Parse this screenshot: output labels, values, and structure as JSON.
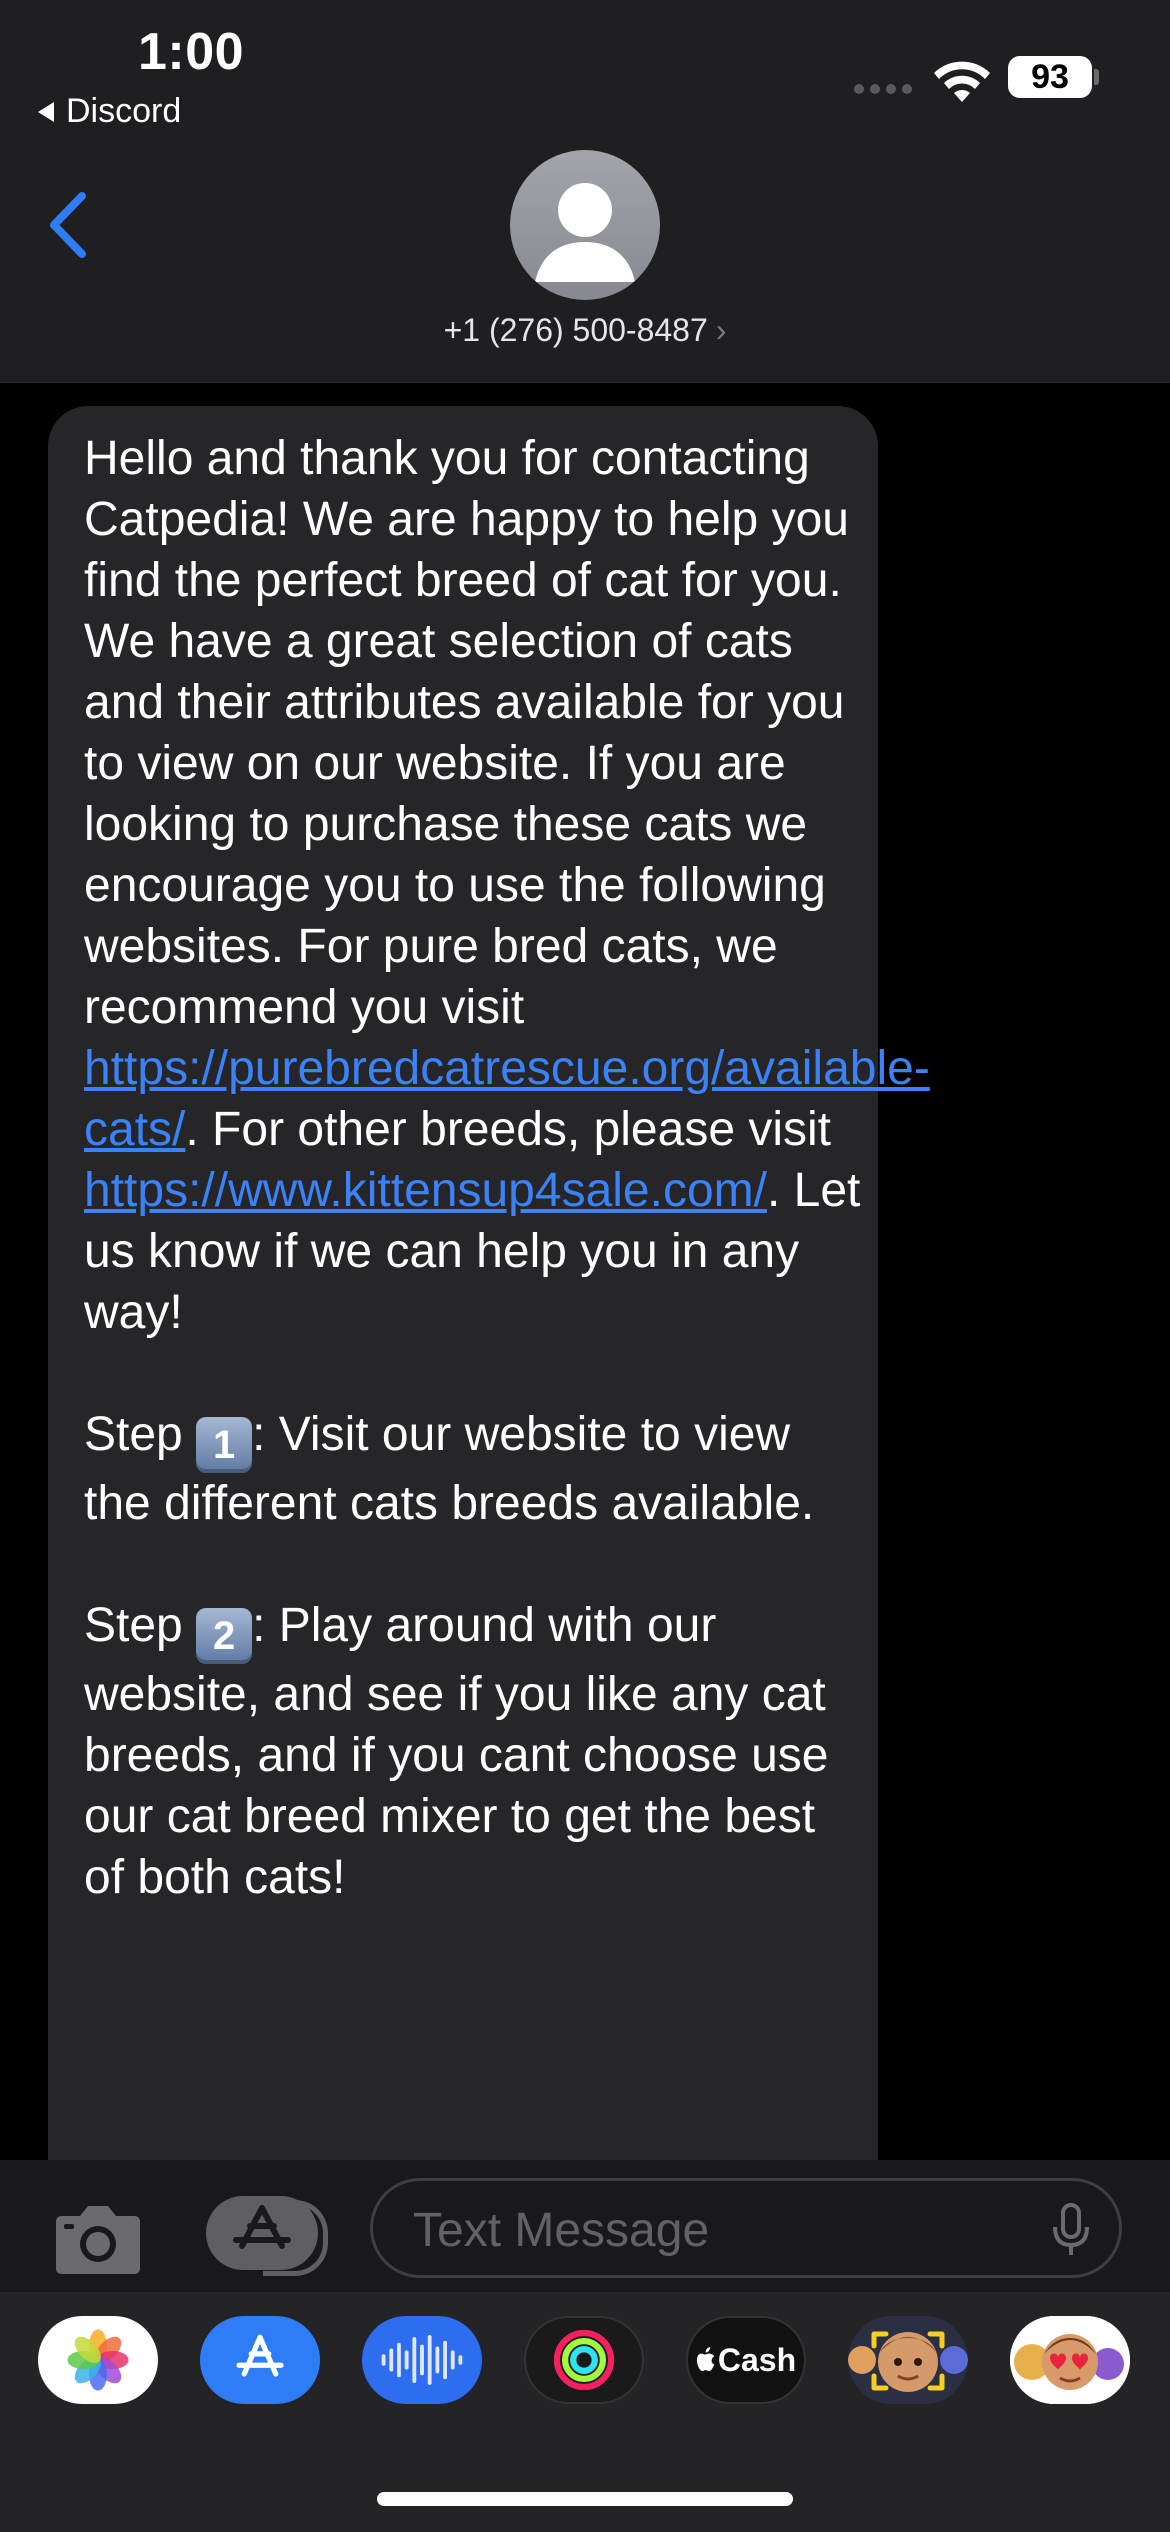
{
  "status_bar": {
    "time": "1:00",
    "back_app": "Discord",
    "battery": "93"
  },
  "header": {
    "contact": "+1 (276) 500-8487",
    "chevron": "›"
  },
  "message": {
    "segments": [
      {
        "text": "Hello and thank you for contacting Catpedia! We are happy to help you find the perfect breed of cat for you. We have a great selection of cats and their attributes available for you to view on our website. If you are looking to purchase these cats we encourage you to use the following websites. For pure bred cats, we recommend you visit "
      },
      {
        "link": "https://purebredcatrescue.org/available-cats/"
      },
      {
        "text": ". For other breeds, please visit "
      },
      {
        "link": "https://www.kittensup4sale.com/"
      },
      {
        "text": ". Let us know if we can help you in any way!\n\nStep "
      },
      {
        "keycap": "1"
      },
      {
        "text": ": Visit our website to view the different cats breeds available.\n\nStep "
      },
      {
        "keycap": "2"
      },
      {
        "text": ": Play around with our website, and see if you like any cat breeds, and if you cant choose use our cat breed mixer to get the best of both cats!"
      }
    ],
    "link_color": "#3b82f6"
  },
  "input": {
    "placeholder": "Text Message"
  },
  "app_strip": {
    "items": [
      "photos-icon",
      "app-store-icon",
      "audio-message-icon",
      "fitness-icon",
      "apple-cash-icon",
      "memoji-icon",
      "memoji-stickers-icon"
    ],
    "cash_label": "Cash"
  }
}
